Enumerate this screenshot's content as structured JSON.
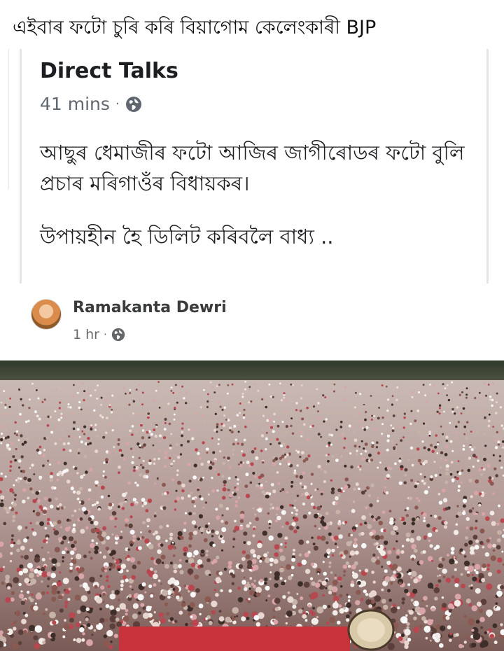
{
  "caption": "এইবাৰ ফটো চুৰি কৰি বিয়াগোম কেলেংকাৰী BJP",
  "post": {
    "page_name": "Direct Talks",
    "time": "41 mins",
    "separator": "·",
    "privacy_icon": "globe-icon",
    "text_line_1": "আছুৰ ধেমাজীৰ ফটো আজিৰ জাগীৰোডৰ ফটো বুলি প্ৰচাৰ মৰিগাওঁৰ বিধায়কৰ।",
    "text_line_2": "উপায়হীন হৈ ডিলিট কৰিবলৈ বাধ্য .."
  },
  "shared_post": {
    "author": "Ramakanta Dewri",
    "time": "1 hr",
    "separator": "·",
    "privacy_icon": "globe-icon",
    "image": "crowd-rally-photo"
  },
  "colors": {
    "text_primary": "#1c1e21",
    "text_secondary": "#606770",
    "card_border": "#e3e5e8"
  }
}
